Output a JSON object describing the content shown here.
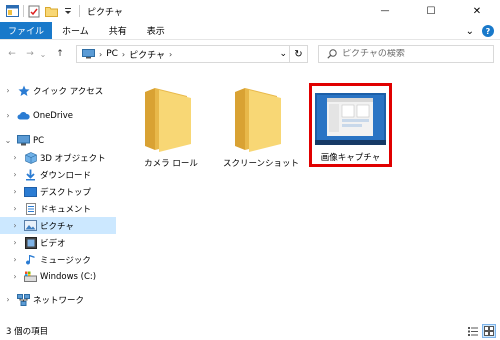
{
  "window": {
    "title": "ピクチャ",
    "controls": {
      "minimize": "—",
      "maximize": "☐",
      "close": "✕"
    }
  },
  "ribbon": {
    "tabs": [
      "ファイル",
      "ホーム",
      "共有",
      "表示"
    ],
    "collapse_icon": "⌄",
    "help_icon": "?"
  },
  "address": {
    "back_icon": "←",
    "forward_icon": "→",
    "recent_icon": "⌄",
    "up_icon": "↑",
    "crumbs": [
      "PC",
      "ピクチャ"
    ],
    "crumb_separator": "›",
    "dropdown_icon": "⌄",
    "refresh_icon": "↻"
  },
  "search": {
    "placeholder": "ピクチャの検索",
    "icon": "⌕"
  },
  "navigation": {
    "items": [
      {
        "label": "クイック アクセス",
        "icon": "star-icon",
        "expander": "›",
        "level": 0
      },
      {
        "label": "OneDrive",
        "icon": "cloud-icon",
        "expander": "›",
        "level": 0
      },
      {
        "label": "PC",
        "icon": "pc-icon",
        "expander": "⌄",
        "level": 0
      },
      {
        "label": "3D オブジェクト",
        "icon": "cube-icon",
        "expander": "›",
        "level": 1
      },
      {
        "label": "ダウンロード",
        "icon": "download-icon",
        "expander": "›",
        "level": 1
      },
      {
        "label": "デスクトップ",
        "icon": "desktop-icon",
        "expander": "›",
        "level": 1
      },
      {
        "label": "ドキュメント",
        "icon": "document-icon",
        "expander": "›",
        "level": 1
      },
      {
        "label": "ピクチャ",
        "icon": "pictures-icon",
        "expander": "›",
        "level": 1,
        "selected": true
      },
      {
        "label": "ビデオ",
        "icon": "video-icon",
        "expander": "›",
        "level": 1
      },
      {
        "label": "ミュージック",
        "icon": "music-icon",
        "expander": "›",
        "level": 1
      },
      {
        "label": "Windows (C:)",
        "icon": "drive-icon",
        "expander": "›",
        "level": 1
      },
      {
        "label": "ネットワーク",
        "icon": "network-icon",
        "expander": "›",
        "level": 0
      }
    ]
  },
  "content": {
    "items": [
      {
        "label": "カメラ ロール",
        "type": "folder"
      },
      {
        "label": "スクリーンショット",
        "type": "folder"
      },
      {
        "label": "画像キャプチャ",
        "type": "image",
        "highlighted": true
      }
    ]
  },
  "status": {
    "item_count": "3 個の項目",
    "views": [
      "details-view-icon",
      "large-icons-view-icon"
    ],
    "active_view": "large-icons-view-icon"
  },
  "colors": {
    "accent": "#1979ca",
    "selection": "#cce8ff",
    "highlight_border": "#e00000",
    "folder": "#f8d775"
  }
}
